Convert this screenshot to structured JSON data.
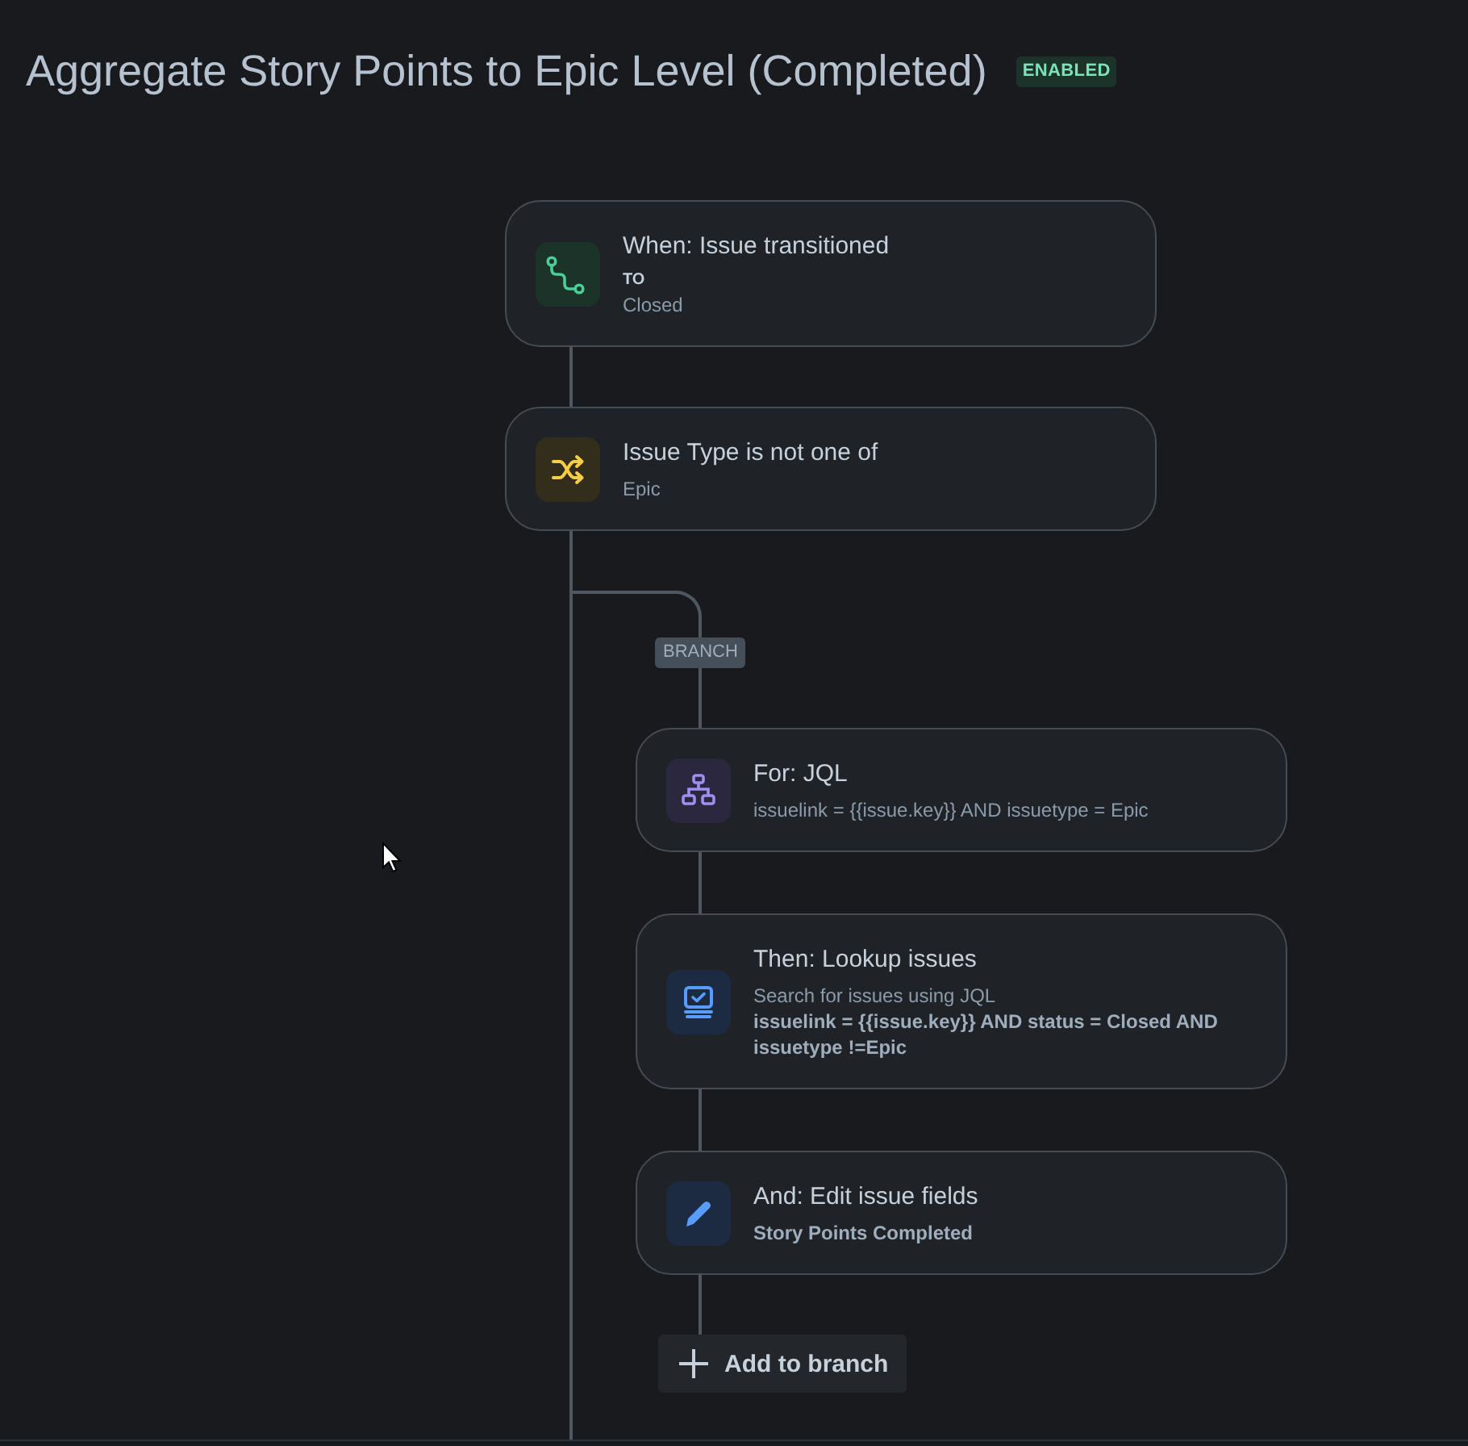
{
  "title": "Aggregate Story Points to Epic Level (Completed)",
  "status": {
    "label": "ENABLED",
    "enabled": true
  },
  "steps": [
    {
      "kind": "trigger",
      "title": "When: Issue transitioned",
      "details": [
        {
          "kind": "label",
          "text": "TO"
        },
        {
          "kind": "text",
          "text": "Closed"
        }
      ]
    },
    {
      "kind": "condition",
      "title": "Issue Type is not one of",
      "details": [
        {
          "kind": "text",
          "text": "Epic"
        }
      ]
    }
  ],
  "branch": {
    "label": "BRANCH",
    "steps": [
      {
        "kind": "for_each",
        "title": "For: JQL",
        "details": [
          {
            "kind": "text",
            "text": "issuelink = {{issue.key}} AND issuetype = Epic"
          }
        ]
      },
      {
        "kind": "lookup",
        "title": "Then: Lookup issues",
        "details": [
          {
            "kind": "text",
            "text": "Search for issues using JQL"
          },
          {
            "kind": "strong",
            "text": "issuelink = {{issue.key}} AND status = Closed AND issuetype !=Epic"
          }
        ]
      },
      {
        "kind": "edit",
        "title": "And: Edit issue fields",
        "details": [
          {
            "kind": "strong",
            "text": "Story Points Completed"
          }
        ]
      }
    ],
    "add_button": "Add to branch"
  }
}
